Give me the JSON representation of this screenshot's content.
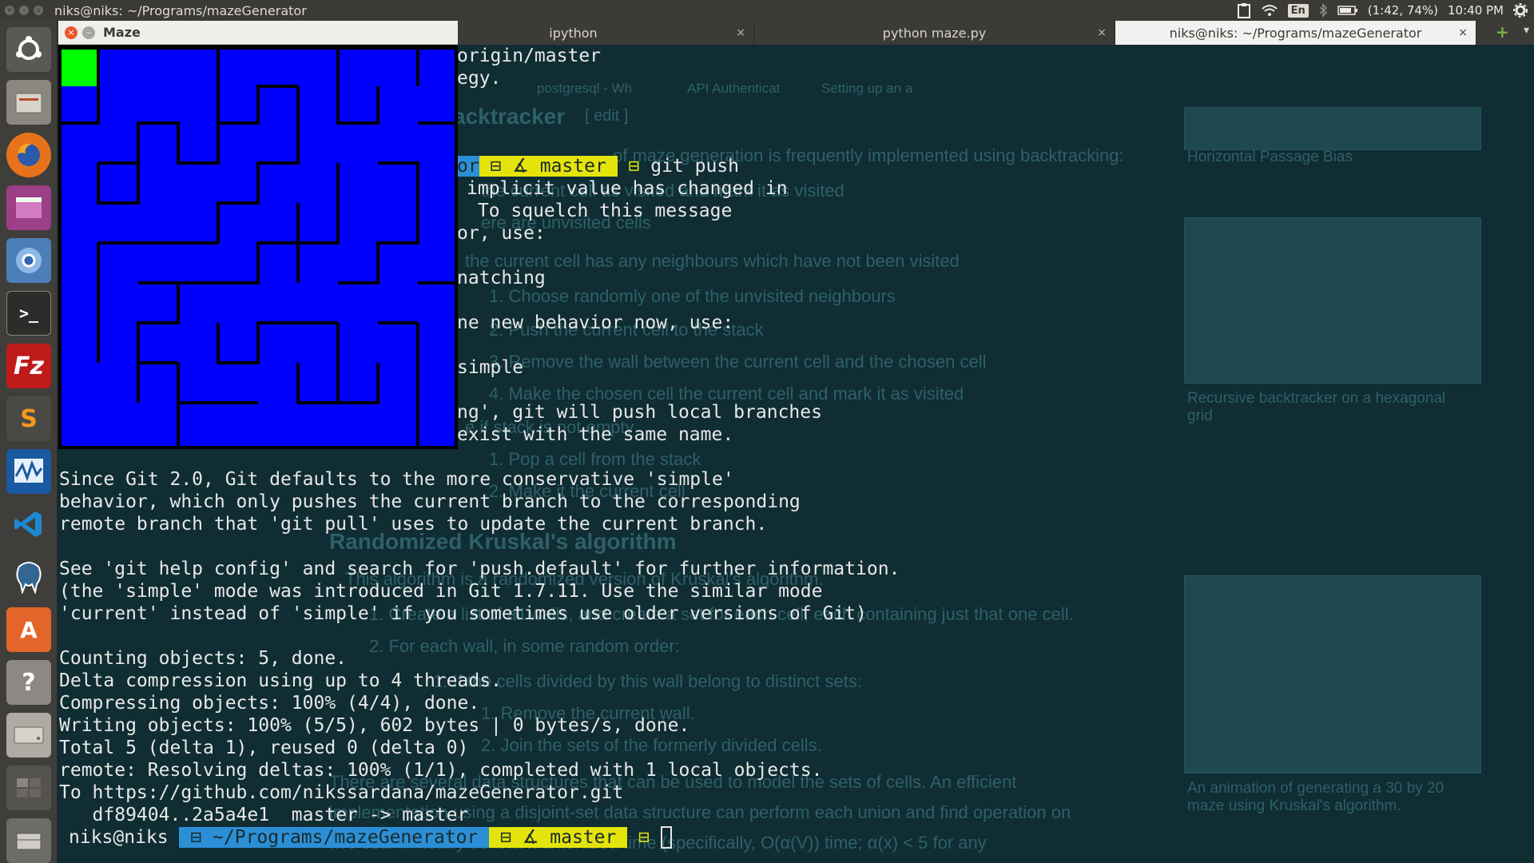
{
  "window": {
    "title": "niks@niks: ~/Programs/mazeGenerator"
  },
  "indicators": {
    "keyboard": "En",
    "battery": "(1:42, 74%)",
    "clock": "10:40 PM"
  },
  "launcher": {
    "items": [
      "ubuntu-dash-icon",
      "files-icon",
      "firefox-icon",
      "unity-app-icon",
      "chromium-icon",
      "terminal-icon",
      "filezilla-icon",
      "sublime-icon",
      "system-monitor-icon",
      "vscode-icon",
      "pgadmin-icon",
      "software-center-icon",
      "help-icon",
      "disk-icon",
      "workspace-icon",
      "trash-icon"
    ]
  },
  "tabs": [
    {
      "label": "ipython",
      "active": false
    },
    {
      "label": "python maze.py",
      "active": false
    },
    {
      "label": "niks@niks: ~/Programs/mazeGenerator",
      "active": true
    }
  ],
  "maze_window": {
    "title": "Maze",
    "colors": {
      "bg": "#0000ff",
      "wall": "#000000",
      "start": "#00ff00"
    }
  },
  "terminal": {
    "lines": [
      "origin/master",
      "egy.",
      "",
      "",
      "",
      "implicit value has changed in",
      " To squelch this message",
      "or, use:",
      "",
      "",
      "natching",
      "",
      "ne new behavior now, use:",
      "",
      "simple",
      "",
      "ng', git will push local branches",
      "exist with the same name.",
      "",
      "Since Git 2.0, Git defaults to the more conservative 'simple'",
      "behavior, which only pushes the current branch to the corresponding",
      "remote branch that 'git pull' uses to update the current branch.",
      "",
      "See 'git help config' and search for 'push.default' for further information.",
      "(the 'simple' mode was introduced in Git 1.7.11. Use the similar mode",
      "'current' instead of 'simple' if you sometimes use older versions of Git)",
      "",
      "Counting objects: 5, done.",
      "Delta compression using up to 4 threads.",
      "Compressing objects: 100% (4/4), done.",
      "Writing objects: 100% (5/5), 602 bytes | 0 bytes/s, done.",
      "Total 5 (delta 1), reused 0 (delta 0)",
      "remote: Resolving deltas: 100% (1/1), completed with 1 local objects.",
      "To https://github.com/nikssardana/mazeGenerator.git",
      "   df89404..2a5a4e1  master -> master"
    ],
    "prompt_top": {
      "path_tail": "or",
      "branch": "master",
      "cmd": "git push"
    },
    "prompt_bottom": {
      "user": "niks@niks",
      "path": "~/Programs/mazeGenerator",
      "branch": "master"
    }
  },
  "background_page": {
    "tabs": [
      "postgresql - Wh",
      "API Authenticat",
      "Setting up an a"
    ],
    "heading1": "acktracker",
    "edit": "[ edit ]",
    "texts": [
      "of maze generation is frequently implemented using backtracking:",
      "the current cell as visited and mark it as visited",
      "ere are unvisited cells",
      "the current cell has any neighbours which have not been visited",
      "1. Choose randomly one of the unvisited neighbours",
      "2. Push the current cell to the stack",
      "3. Remove the wall between the current cell and the chosen cell",
      "4. Make the chosen cell the current cell and mark it as visited",
      "e if stack is not empty",
      "1. Pop a cell from the stack",
      "2. Make it the current cell",
      "Randomized Kruskal's algorithm",
      "This algorithm is a randomized version of Kruskal's algorithm.",
      "1. Create a list of all walls, and create a set for each cell, each containing just that one cell.",
      "2. For each wall, in some random order:",
      "1. If the cells divided by this wall belong to distinct sets:",
      "1. Remove the current wall.",
      "2. Join the sets of the formerly divided cells.",
      "There are several data structures that can be used to model the sets of cells. An efficient",
      "implementation using a disjoint-set data structure can perform each union and find operation on",
      "two sets in nearly constant amortized time (specifically, O(α(V)) time; α(x) < 5 for any"
    ],
    "captions": [
      "Horizontal Passage Bias",
      "Recursive backtracker on a hexagonal grid",
      "An animation of generating a 30 by 20 maze using Kruskal's algorithm."
    ]
  }
}
